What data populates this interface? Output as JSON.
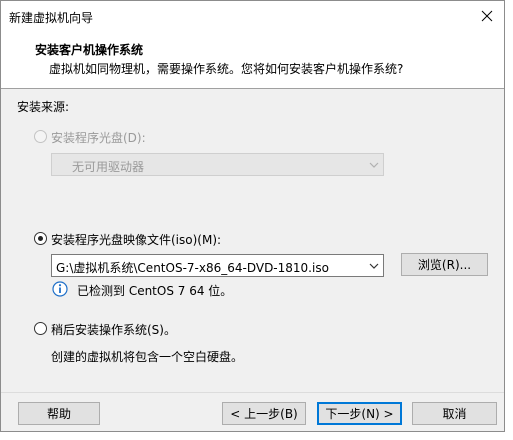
{
  "window": {
    "title": "新建虚拟机向导"
  },
  "header": {
    "title": "安装客户机操作系统",
    "subtitle": "虚拟机如同物理机，需要操作系统。您将如何安装客户机操作系统?"
  },
  "source": {
    "label": "安装来源:",
    "options": [
      {
        "label": "安装程序光盘(D):",
        "checked": false,
        "enabled": false,
        "combo_value": "无可用驱动器"
      },
      {
        "label": "安装程序光盘映像文件(iso)(M):",
        "checked": true,
        "enabled": true,
        "combo_value": "G:\\虚拟机系统\\CentOS-7-x86_64-DVD-1810.iso",
        "browse_label": "浏览(R)...",
        "detected_text": "已检测到 CentOS 7 64 位。"
      },
      {
        "label": "稍后安装操作系统(S)。",
        "checked": false,
        "enabled": true,
        "description": "创建的虚拟机将包含一个空白硬盘。"
      }
    ]
  },
  "footer": {
    "help": "帮助",
    "back": "< 上一步(B)",
    "next": "下一步(N) >",
    "cancel": "取消"
  },
  "colors": {
    "accent": "#0078d7",
    "info": "#1e6fc8"
  }
}
